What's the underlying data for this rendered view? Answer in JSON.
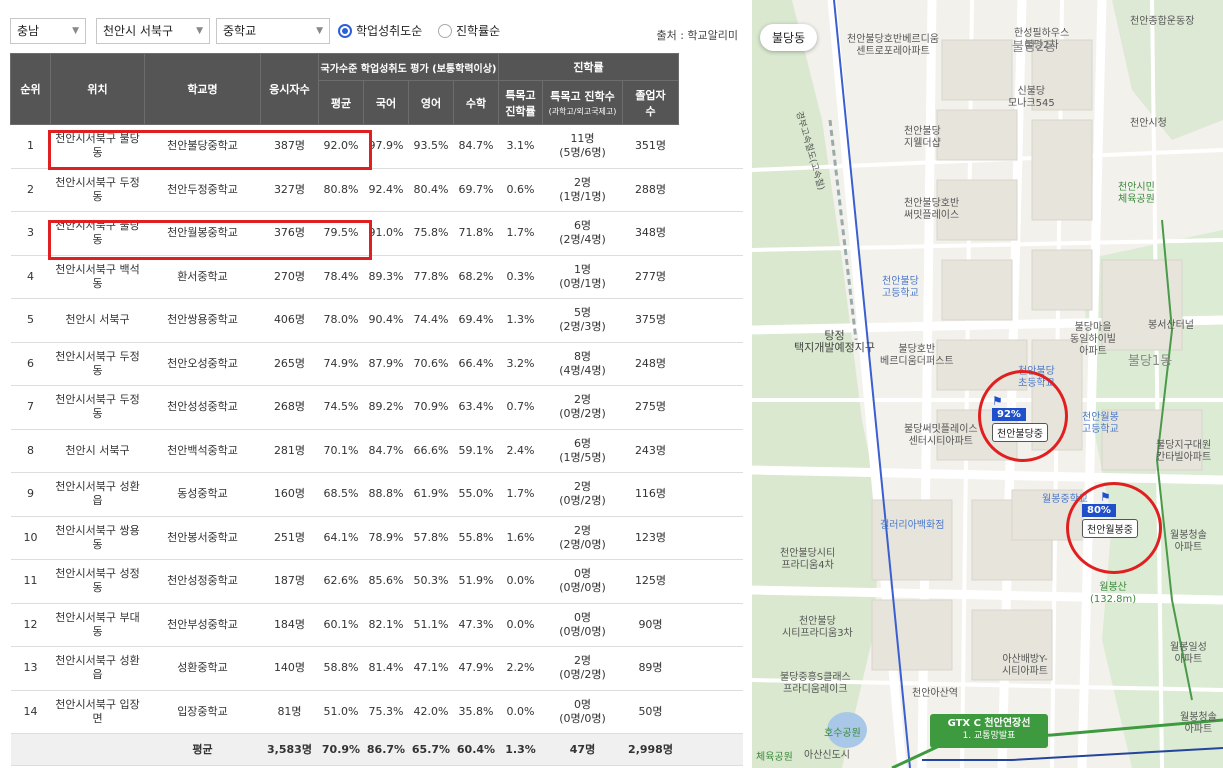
{
  "filters": {
    "province": "충남",
    "district": "천안시 서북구",
    "school_level": "중학교",
    "radio_options": [
      {
        "label": "학업성취도순",
        "selected": true
      },
      {
        "label": "진학률순",
        "selected": false
      }
    ],
    "source": "출처 : 학교알리미"
  },
  "table": {
    "headers": {
      "rank": "순위",
      "location": "위치",
      "school": "학교명",
      "test_takers": "응시자수",
      "group_achievement": "국가수준 학업성취도 평가 (보통학력이상)",
      "average": "평균",
      "korean": "국어",
      "english": "영어",
      "math": "수학",
      "group_advancement": "진학률",
      "special_rate": "특목고 진학률",
      "special_count": "특목고 진학수",
      "special_count_sub": "(과학고/외고국제고)",
      "graduates": "졸업자 수"
    },
    "rows": [
      {
        "rank": "1",
        "location": "천안시서북구 불당동",
        "school": "천안불당중학교",
        "takers": "387명",
        "avg": "92.0%",
        "kor": "97.9%",
        "eng": "93.5%",
        "math": "84.7%",
        "srate": "3.1%",
        "scount": "11명",
        "sdetail": "(5명/6명)",
        "grads": "351명"
      },
      {
        "rank": "2",
        "location": "천안시서북구 두정동",
        "school": "천안두정중학교",
        "takers": "327명",
        "avg": "80.8%",
        "kor": "92.4%",
        "eng": "80.4%",
        "math": "69.7%",
        "srate": "0.6%",
        "scount": "2명",
        "sdetail": "(1명/1명)",
        "grads": "288명"
      },
      {
        "rank": "3",
        "location": "천안시서북구 불당동",
        "school": "천안월봉중학교",
        "takers": "376명",
        "avg": "79.5%",
        "kor": "91.0%",
        "eng": "75.8%",
        "math": "71.8%",
        "srate": "1.7%",
        "scount": "6명",
        "sdetail": "(2명/4명)",
        "grads": "348명"
      },
      {
        "rank": "4",
        "location": "천안시서북구 백석동",
        "school": "환서중학교",
        "takers": "270명",
        "avg": "78.4%",
        "kor": "89.3%",
        "eng": "77.8%",
        "math": "68.2%",
        "srate": "0.3%",
        "scount": "1명",
        "sdetail": "(0명/1명)",
        "grads": "277명"
      },
      {
        "rank": "5",
        "location": "천안시 서북구",
        "school": "천안쌍용중학교",
        "takers": "406명",
        "avg": "78.0%",
        "kor": "90.4%",
        "eng": "74.4%",
        "math": "69.4%",
        "srate": "1.3%",
        "scount": "5명",
        "sdetail": "(2명/3명)",
        "grads": "375명"
      },
      {
        "rank": "6",
        "location": "천안시서북구 두정동",
        "school": "천안오성중학교",
        "takers": "265명",
        "avg": "74.9%",
        "kor": "87.9%",
        "eng": "70.6%",
        "math": "66.4%",
        "srate": "3.2%",
        "scount": "8명",
        "sdetail": "(4명/4명)",
        "grads": "248명"
      },
      {
        "rank": "7",
        "location": "천안시서북구 두정동",
        "school": "천안성성중학교",
        "takers": "268명",
        "avg": "74.5%",
        "kor": "89.2%",
        "eng": "70.9%",
        "math": "63.4%",
        "srate": "0.7%",
        "scount": "2명",
        "sdetail": "(0명/2명)",
        "grads": "275명"
      },
      {
        "rank": "8",
        "location": "천안시 서북구",
        "school": "천안백석중학교",
        "takers": "281명",
        "avg": "70.1%",
        "kor": "84.7%",
        "eng": "66.6%",
        "math": "59.1%",
        "srate": "2.4%",
        "scount": "6명",
        "sdetail": "(1명/5명)",
        "grads": "243명"
      },
      {
        "rank": "9",
        "location": "천안시서북구 성환읍",
        "school": "동성중학교",
        "takers": "160명",
        "avg": "68.5%",
        "kor": "88.8%",
        "eng": "61.9%",
        "math": "55.0%",
        "srate": "1.7%",
        "scount": "2명",
        "sdetail": "(0명/2명)",
        "grads": "116명"
      },
      {
        "rank": "10",
        "location": "천안시서북구 쌍용동",
        "school": "천안봉서중학교",
        "takers": "251명",
        "avg": "64.1%",
        "kor": "78.9%",
        "eng": "57.8%",
        "math": "55.8%",
        "srate": "1.6%",
        "scount": "2명",
        "sdetail": "(2명/0명)",
        "grads": "123명"
      },
      {
        "rank": "11",
        "location": "천안시서북구 성정동",
        "school": "천안성정중학교",
        "takers": "187명",
        "avg": "62.6%",
        "kor": "85.6%",
        "eng": "50.3%",
        "math": "51.9%",
        "srate": "0.0%",
        "scount": "0명",
        "sdetail": "(0명/0명)",
        "grads": "125명"
      },
      {
        "rank": "12",
        "location": "천안시서북구 부대동",
        "school": "천안부성중학교",
        "takers": "184명",
        "avg": "60.1%",
        "kor": "82.1%",
        "eng": "51.1%",
        "math": "47.3%",
        "srate": "0.0%",
        "scount": "0명",
        "sdetail": "(0명/0명)",
        "grads": "90명"
      },
      {
        "rank": "13",
        "location": "천안시서북구 성환읍",
        "school": "성환중학교",
        "takers": "140명",
        "avg": "58.8%",
        "kor": "81.4%",
        "eng": "47.1%",
        "math": "47.9%",
        "srate": "2.2%",
        "scount": "2명",
        "sdetail": "(0명/2명)",
        "grads": "89명"
      },
      {
        "rank": "14",
        "location": "천안시서북구 입장면",
        "school": "입장중학교",
        "takers": "81명",
        "avg": "51.0%",
        "kor": "75.3%",
        "eng": "42.0%",
        "math": "35.8%",
        "srate": "0.0%",
        "scount": "0명",
        "sdetail": "(0명/0명)",
        "grads": "50명"
      }
    ],
    "average_row": {
      "label": "평균",
      "takers": "3,583명",
      "avg": "70.9%",
      "kor": "86.7%",
      "eng": "65.7%",
      "math": "60.4%",
      "srate": "1.3%",
      "scount": "47명",
      "grads": "2,998명"
    }
  },
  "map": {
    "region": "불당동",
    "labels": {
      "l1": "천안불당호반베르디움\n센트로포레아파트",
      "l2": "한성필하우스\n불당2차",
      "l3": "불당2동",
      "l4": "신불당\n모나크545",
      "l5": "천안불당\n지웰더샵",
      "l6": "천안시청",
      "l7": "천안시민\n체육공원",
      "l8": "천안불당호반\n써밋플레이스",
      "l9": "천안불당\n고등학교",
      "l10": "탕정\n택지개발예정지구",
      "l11": "불당호반\n베르디움더퍼스트",
      "l12": "불당마을\n동일하이빌\n아파트",
      "l13": "봉서산터널",
      "l14": "불당1동",
      "l15": "천안불당\n초등학교",
      "l16": "천안월봉\n고등학교",
      "l17": "불당써밋플레이스\n센터시티아파트",
      "l18": "불당지구대원\n칸타빌아파트",
      "l19": "갤러리아백화점",
      "l20": "천안불당시티\n프라디움4차",
      "l21": "월봉청솔\n아파트",
      "l22": "월봉산\n(132.8m)",
      "l23": "천안불당\n시티프라디움3차",
      "l24": "월봉일성\n아파트",
      "l25": "불당중흥S클래스\n프라디움레이크",
      "l26": "아산배방Y-\n시티아파트",
      "l27": "천안아산역",
      "l28": "호수공원",
      "l29": "체육공원",
      "l30": "아산신도시",
      "l31": "월봉청솔\n아파트",
      "l32": "천안종합운동장",
      "l33": "월봉중학교",
      "l34": "경부고속철도(고속철)"
    },
    "pins": [
      {
        "pct": "92%",
        "name": "천안불당중"
      },
      {
        "pct": "80%",
        "name": "천안월봉중"
      }
    ],
    "gtx": {
      "title": "GTX C 천안연장선",
      "subtitle": "1. 교통망발표"
    },
    "colors": {
      "pin": "#1f4fc9",
      "highlight": "#e02020",
      "gtx": "#3e9a3e",
      "rail": "#3b5fd0"
    }
  }
}
